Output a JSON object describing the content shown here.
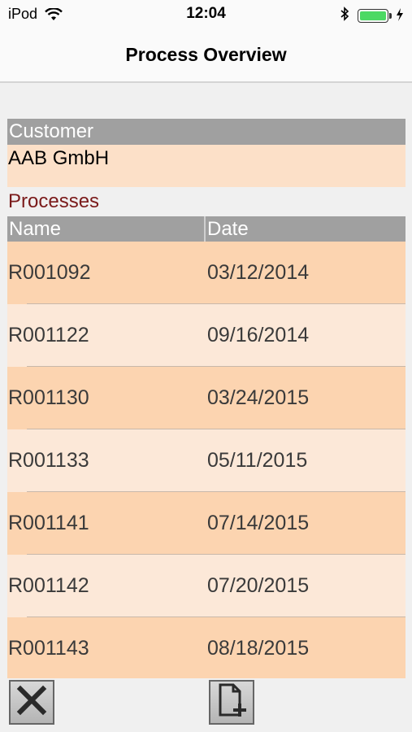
{
  "status_bar": {
    "carrier": "iPod",
    "time": "12:04"
  },
  "nav": {
    "title": "Process Overview"
  },
  "customer": {
    "header": "Customer",
    "value": "AAB GmbH"
  },
  "processes": {
    "label": "Processes",
    "columns": [
      "Name",
      "Date"
    ],
    "rows": [
      {
        "name": "R001092",
        "date": "03/12/2014"
      },
      {
        "name": "R001122",
        "date": "09/16/2014"
      },
      {
        "name": "R001130",
        "date": "03/24/2015"
      },
      {
        "name": "R001133",
        "date": "05/11/2015"
      },
      {
        "name": "R001141",
        "date": "07/14/2015"
      },
      {
        "name": "R001142",
        "date": "07/20/2015"
      },
      {
        "name": "R001143",
        "date": "08/18/2015"
      }
    ]
  },
  "toolbar": {
    "close_icon": "close-x-icon",
    "new_icon": "new-document-icon"
  },
  "colors": {
    "header_gray": "#a0a0a0",
    "row_dark": "#fcd4b0",
    "row_light": "#fce8d8",
    "processes_label": "#7a1a1a",
    "battery": "#4cd964"
  }
}
